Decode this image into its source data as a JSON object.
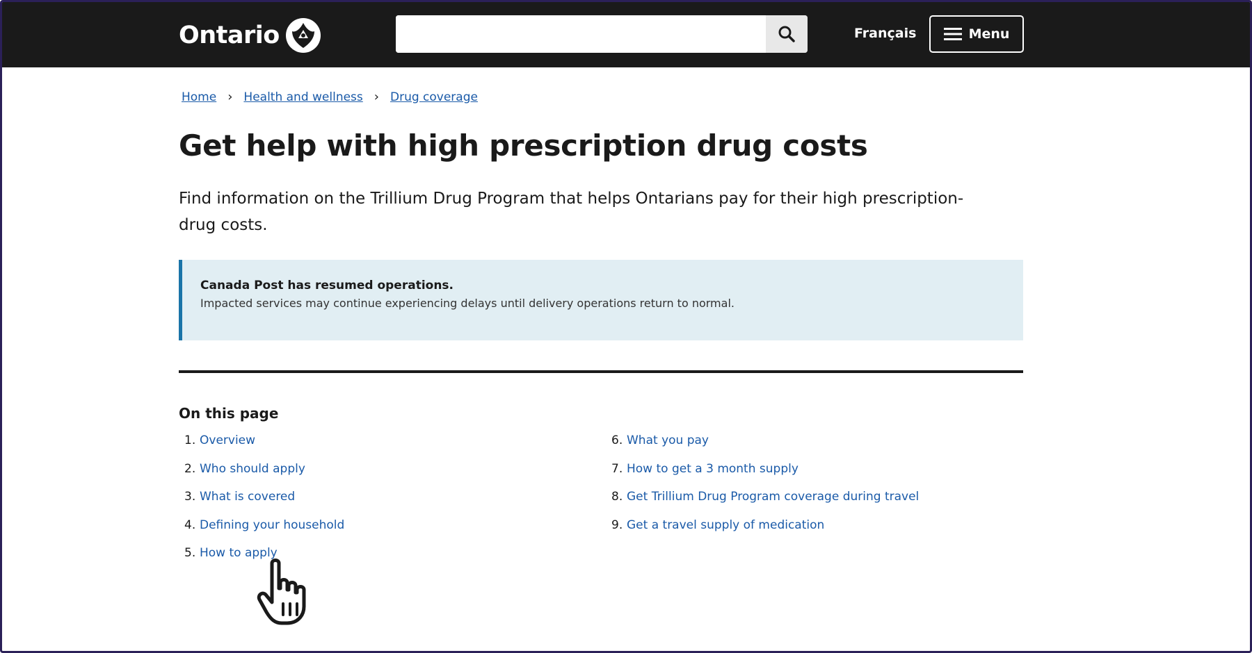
{
  "header": {
    "logo_text": "Ontario",
    "logo_icon": "trillium-icon",
    "search": {
      "value": "",
      "placeholder": "",
      "icon": "search-icon"
    },
    "language_link": "Français",
    "menu_label": "Menu",
    "menu_icon": "hamburger-icon"
  },
  "breadcrumb": [
    {
      "label": "Home"
    },
    {
      "label": "Health and wellness"
    },
    {
      "label": "Drug coverage"
    }
  ],
  "page": {
    "title": "Get help with high prescription drug costs",
    "lead": "Find information on the Trillium Drug Program that helps Ontarians pay for their high prescription-drug costs."
  },
  "alert": {
    "title": "Canada Post has resumed operations.",
    "body": "Impacted services may continue experiencing delays until delivery operations return to normal."
  },
  "toc": {
    "heading": "On this page",
    "items": [
      {
        "num": "1.",
        "label": "Overview"
      },
      {
        "num": "2.",
        "label": "Who should apply"
      },
      {
        "num": "3.",
        "label": "What is covered"
      },
      {
        "num": "4.",
        "label": "Defining your household"
      },
      {
        "num": "5.",
        "label": "How to apply"
      },
      {
        "num": "6.",
        "label": "What you pay"
      },
      {
        "num": "7.",
        "label": "How to get a 3 month supply"
      },
      {
        "num": "8.",
        "label": "Get Trillium Drug Program coverage during travel"
      },
      {
        "num": "9.",
        "label": "Get a travel supply of medication"
      }
    ]
  },
  "colors": {
    "header_bg": "#1a1a1a",
    "link": "#1a5aa8",
    "alert_bg": "#e1eef3",
    "alert_border": "#1a74a8",
    "frame": "#2b2058"
  },
  "cursor_icon": "hand-pointer-icon"
}
